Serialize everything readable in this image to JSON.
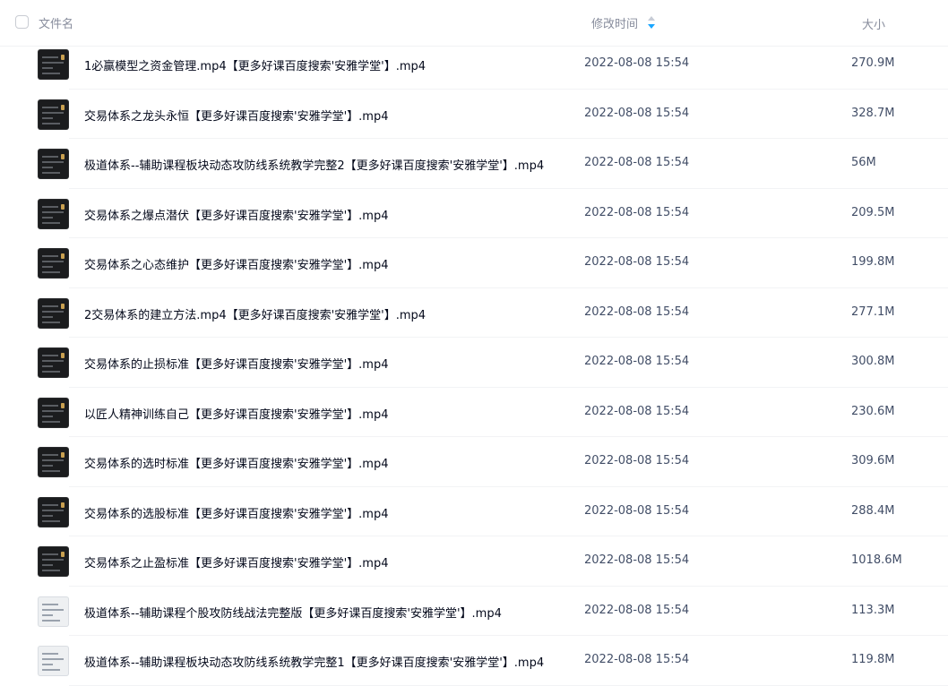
{
  "header": {
    "name_label": "文件名",
    "time_label": "修改时间",
    "size_label": "大小",
    "sort_icon": "sort-arrows-icon"
  },
  "colors": {
    "header_text": "#878c9c",
    "sort_active": "#1aa6ff",
    "row_text": "#03081a",
    "meta_text": "#424e67"
  },
  "files": [
    {
      "name": "1必赢模型之资金管理.mp4【更多好课百度搜索'安雅学堂'】.mp4",
      "time": "2022-08-08 15:54",
      "size": "270.9M",
      "thumb": "dark"
    },
    {
      "name": "交易体系之龙头永恒【更多好课百度搜索'安雅学堂'】.mp4",
      "time": "2022-08-08 15:54",
      "size": "328.7M",
      "thumb": "dark"
    },
    {
      "name": "极道体系--辅助课程板块动态攻防线系统教学完整2【更多好课百度搜索'安雅学堂'】.mp4",
      "time": "2022-08-08 15:54",
      "size": "56M",
      "thumb": "dark"
    },
    {
      "name": "交易体系之爆点潜伏【更多好课百度搜索'安雅学堂'】.mp4",
      "time": "2022-08-08 15:54",
      "size": "209.5M",
      "thumb": "dark"
    },
    {
      "name": "交易体系之心态维护【更多好课百度搜索'安雅学堂'】.mp4",
      "time": "2022-08-08 15:54",
      "size": "199.8M",
      "thumb": "dark"
    },
    {
      "name": "2交易体系的建立方法.mp4【更多好课百度搜索'安雅学堂'】.mp4",
      "time": "2022-08-08 15:54",
      "size": "277.1M",
      "thumb": "dark"
    },
    {
      "name": "交易体系的止损标准【更多好课百度搜索'安雅学堂'】.mp4",
      "time": "2022-08-08 15:54",
      "size": "300.8M",
      "thumb": "dark"
    },
    {
      "name": "以匠人精神训练自己【更多好课百度搜索'安雅学堂'】.mp4",
      "time": "2022-08-08 15:54",
      "size": "230.6M",
      "thumb": "dark"
    },
    {
      "name": "交易体系的选时标准【更多好课百度搜索'安雅学堂'】.mp4",
      "time": "2022-08-08 15:54",
      "size": "309.6M",
      "thumb": "dark"
    },
    {
      "name": "交易体系的选股标准【更多好课百度搜索'安雅学堂'】.mp4",
      "time": "2022-08-08 15:54",
      "size": "288.4M",
      "thumb": "dark"
    },
    {
      "name": "交易体系之止盈标准【更多好课百度搜索'安雅学堂'】.mp4",
      "time": "2022-08-08 15:54",
      "size": "1018.6M",
      "thumb": "dark"
    },
    {
      "name": "极道体系--辅助课程个股攻防线战法完整版【更多好课百度搜索'安雅学堂'】.mp4",
      "time": "2022-08-08 15:54",
      "size": "113.3M",
      "thumb": "light"
    },
    {
      "name": "极道体系--辅助课程板块动态攻防线系统教学完整1【更多好课百度搜索'安雅学堂'】.mp4",
      "time": "2022-08-08 15:54",
      "size": "119.8M",
      "thumb": "light"
    }
  ]
}
